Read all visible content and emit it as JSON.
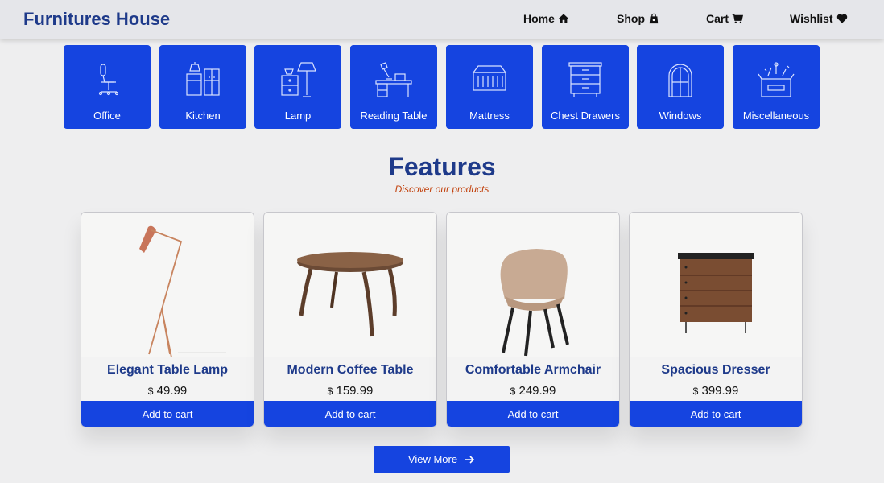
{
  "header": {
    "brand": "Furnitures House",
    "nav": [
      {
        "label": "Home",
        "icon": "home-icon"
      },
      {
        "label": "Shop",
        "icon": "shopping-bag-icon"
      },
      {
        "label": "Cart",
        "icon": "cart-icon"
      },
      {
        "label": "Wishlist",
        "icon": "heart-icon"
      }
    ]
  },
  "categories": [
    {
      "label": "Office",
      "icon": "office-chair-icon"
    },
    {
      "label": "Kitchen",
      "icon": "kitchen-icon"
    },
    {
      "label": "Lamp",
      "icon": "lamp-icon"
    },
    {
      "label": "Reading Table",
      "icon": "reading-table-icon"
    },
    {
      "label": "Mattress",
      "icon": "mattress-icon"
    },
    {
      "label": "Chest Drawers",
      "icon": "chest-drawers-icon"
    },
    {
      "label": "Windows",
      "icon": "window-icon"
    },
    {
      "label": "Miscellaneous",
      "icon": "miscellaneous-box-icon"
    }
  ],
  "features": {
    "title": "Features",
    "subtitle": "Discover our products"
  },
  "products": [
    {
      "name": "Elegant Table Lamp",
      "currency": "$",
      "price": "49.99",
      "button": "Add to cart"
    },
    {
      "name": "Modern Coffee Table",
      "currency": "$",
      "price": "159.99",
      "button": "Add to cart"
    },
    {
      "name": "Comfortable Armchair",
      "currency": "$",
      "price": "249.99",
      "button": "Add to cart"
    },
    {
      "name": "Spacious Dresser",
      "currency": "$",
      "price": "399.99",
      "button": "Add to cart"
    }
  ],
  "view_more": {
    "label": "View More",
    "icon": "arrow-right-icon"
  },
  "colors": {
    "primary": "#1544e0",
    "brand_text": "#1e3a8a",
    "subtitle": "#c2410c",
    "background": "#eeeeef"
  }
}
